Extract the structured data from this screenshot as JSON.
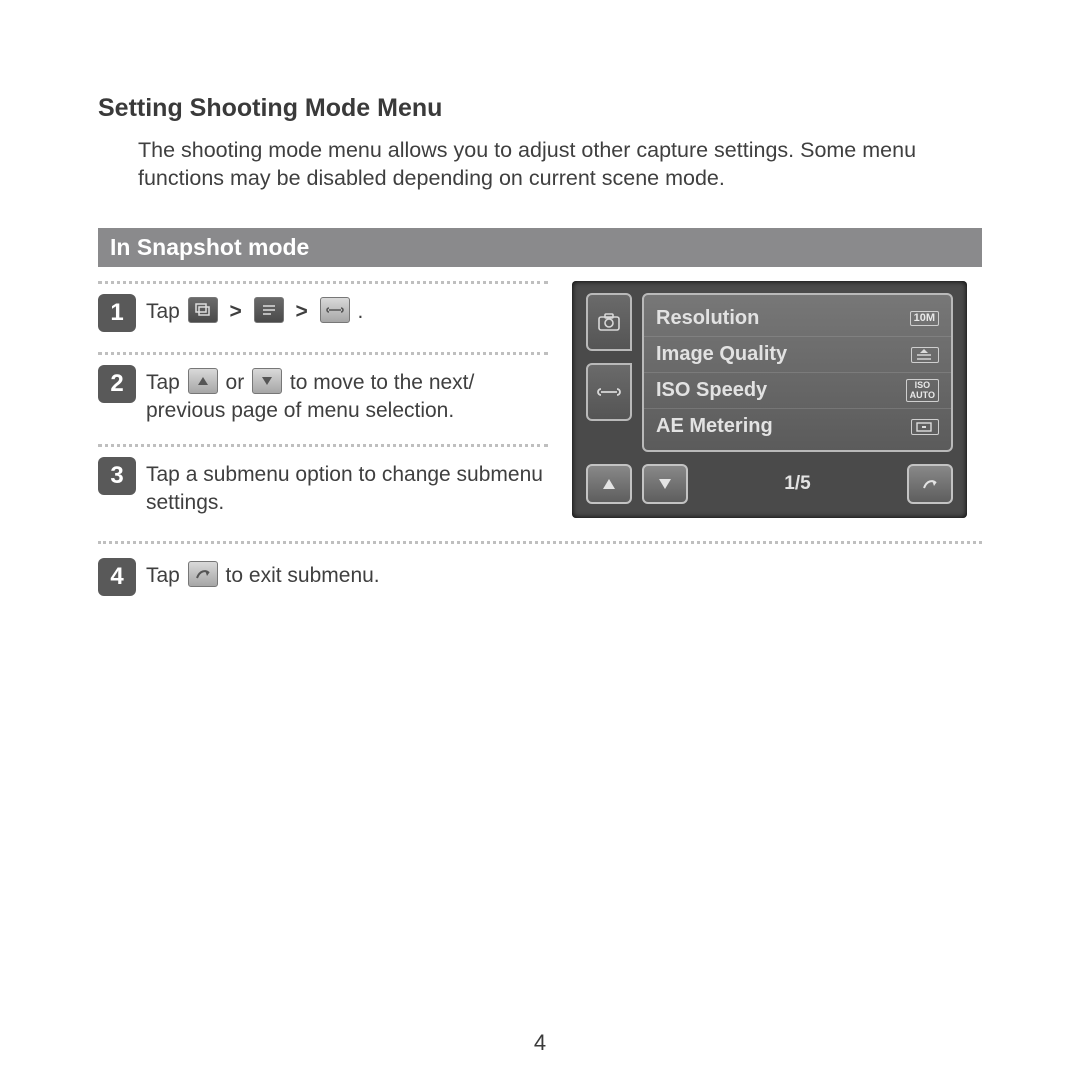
{
  "heading": "Setting Shooting Mode Menu",
  "intro": "The shooting mode menu allows you to adjust other capture settings. Some menu functions may be disabled depending on current scene mode.",
  "mode_bar": "In Snapshot mode",
  "steps": [
    {
      "num": "1",
      "pre": "Tap ",
      "post": " ."
    },
    {
      "num": "2",
      "pre": "Tap ",
      "mid": " or ",
      "post": " to move to the next/ previous page of menu selection."
    },
    {
      "num": "3",
      "text": "Tap a submenu option to change submenu settings."
    },
    {
      "num": "4",
      "pre": "Tap ",
      "post": " to exit submenu."
    }
  ],
  "gt": ">",
  "screen": {
    "items": [
      {
        "label": "Resolution",
        "value": "10M"
      },
      {
        "label": "Image Quality",
        "value": ""
      },
      {
        "label": "ISO Speedy",
        "value": "ISO\nAUTO"
      },
      {
        "label": "AE Metering",
        "value": ""
      }
    ],
    "pager": "1/5"
  },
  "page_number": "4"
}
